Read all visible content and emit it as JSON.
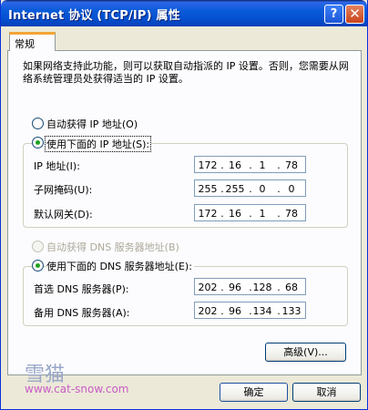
{
  "window": {
    "title": "Internet 协议 (TCP/IP) 属性",
    "help_label": "?",
    "close_label": "✕"
  },
  "tabs": [
    {
      "label": "常规"
    }
  ],
  "description": "如果网络支持此功能，则可以获取自动指派的 IP 设置。否则，您需要从网络系统管理员处获得适当的 IP 设置。",
  "ip_section": {
    "auto_label": "自动获得 IP 地址(O)",
    "manual_label": "使用下面的 IP 地址(S):",
    "selected": "manual",
    "fields": [
      {
        "label": "IP 地址(I):",
        "octets": [
          "172",
          "16",
          "1",
          "78"
        ]
      },
      {
        "label": "子网掩码(U):",
        "octets": [
          "255",
          "255",
          "0",
          "0"
        ]
      },
      {
        "label": "默认网关(D):",
        "octets": [
          "172",
          "16",
          "1",
          "78"
        ]
      }
    ]
  },
  "dns_section": {
    "auto_label": "自动获得 DNS 服务器地址(B)",
    "manual_label": "使用下面的 DNS 服务器地址(E):",
    "selected": "manual",
    "fields": [
      {
        "label": "首选 DNS 服务器(P):",
        "octets": [
          "202",
          "96",
          "128",
          "68"
        ]
      },
      {
        "label": "备用 DNS 服务器(A):",
        "octets": [
          "202",
          "96",
          "134",
          "133"
        ]
      }
    ]
  },
  "buttons": {
    "advanced": "高级(V)...",
    "ok": "确定",
    "cancel": "取消"
  },
  "watermark": {
    "logo": "雪猫",
    "url": "www.cat-snow.com"
  },
  "colors": {
    "titlebar": "#0a5bd9",
    "dialog": "#ece9d8",
    "tab_accent": "#f3a537",
    "radio_dot": "#21a121"
  }
}
